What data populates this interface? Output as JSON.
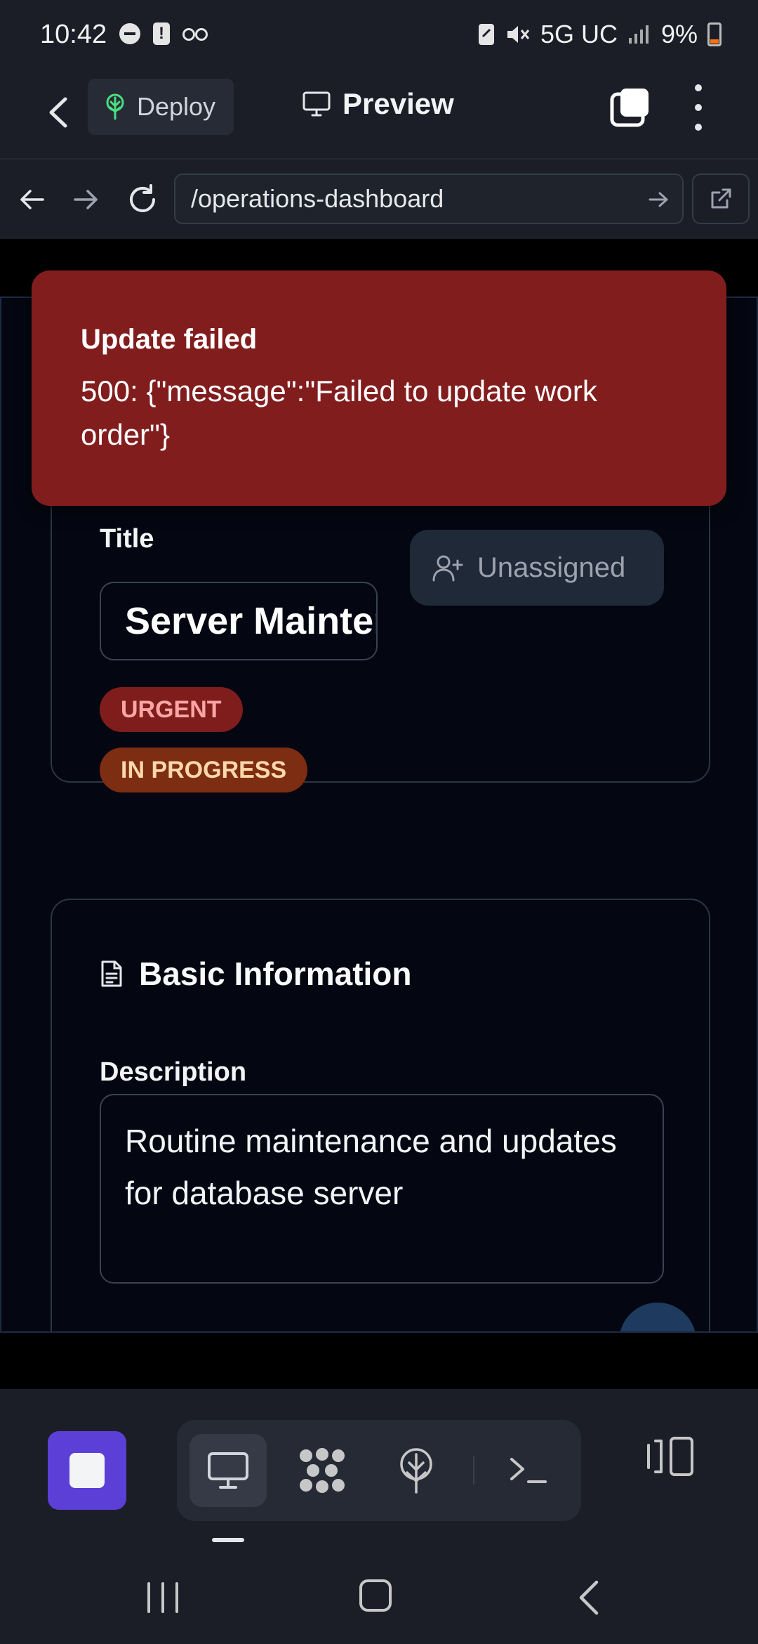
{
  "status_bar": {
    "time": "10:42",
    "network": "5G UC",
    "battery": "9%"
  },
  "app_bar": {
    "deploy_label": "Deploy",
    "preview_label": "Preview"
  },
  "browser": {
    "url": "/operations-dashboard"
  },
  "toast": {
    "title": "Update failed",
    "message": "500: {\"message\":\"Failed to update work order\"}"
  },
  "work_order": {
    "title_label": "Title",
    "title_value": "Server Maintenance",
    "assignee_label": "Unassigned",
    "priority_badge": "URGENT",
    "status_badge": "IN PROGRESS"
  },
  "basic_info": {
    "heading": "Basic Information",
    "description_label": "Description",
    "description_value": "Routine maintenance and updates for database server"
  },
  "colors": {
    "toast_bg": "#821d1e",
    "accent": "#5b3fd6",
    "urgent_bg": "#7f1d1d",
    "progress_bg": "#7c2d12"
  },
  "icons": {
    "deploy": "deploy-tree-icon",
    "preview": "monitor-icon",
    "assign": "user-plus-icon",
    "section": "document-icon"
  }
}
